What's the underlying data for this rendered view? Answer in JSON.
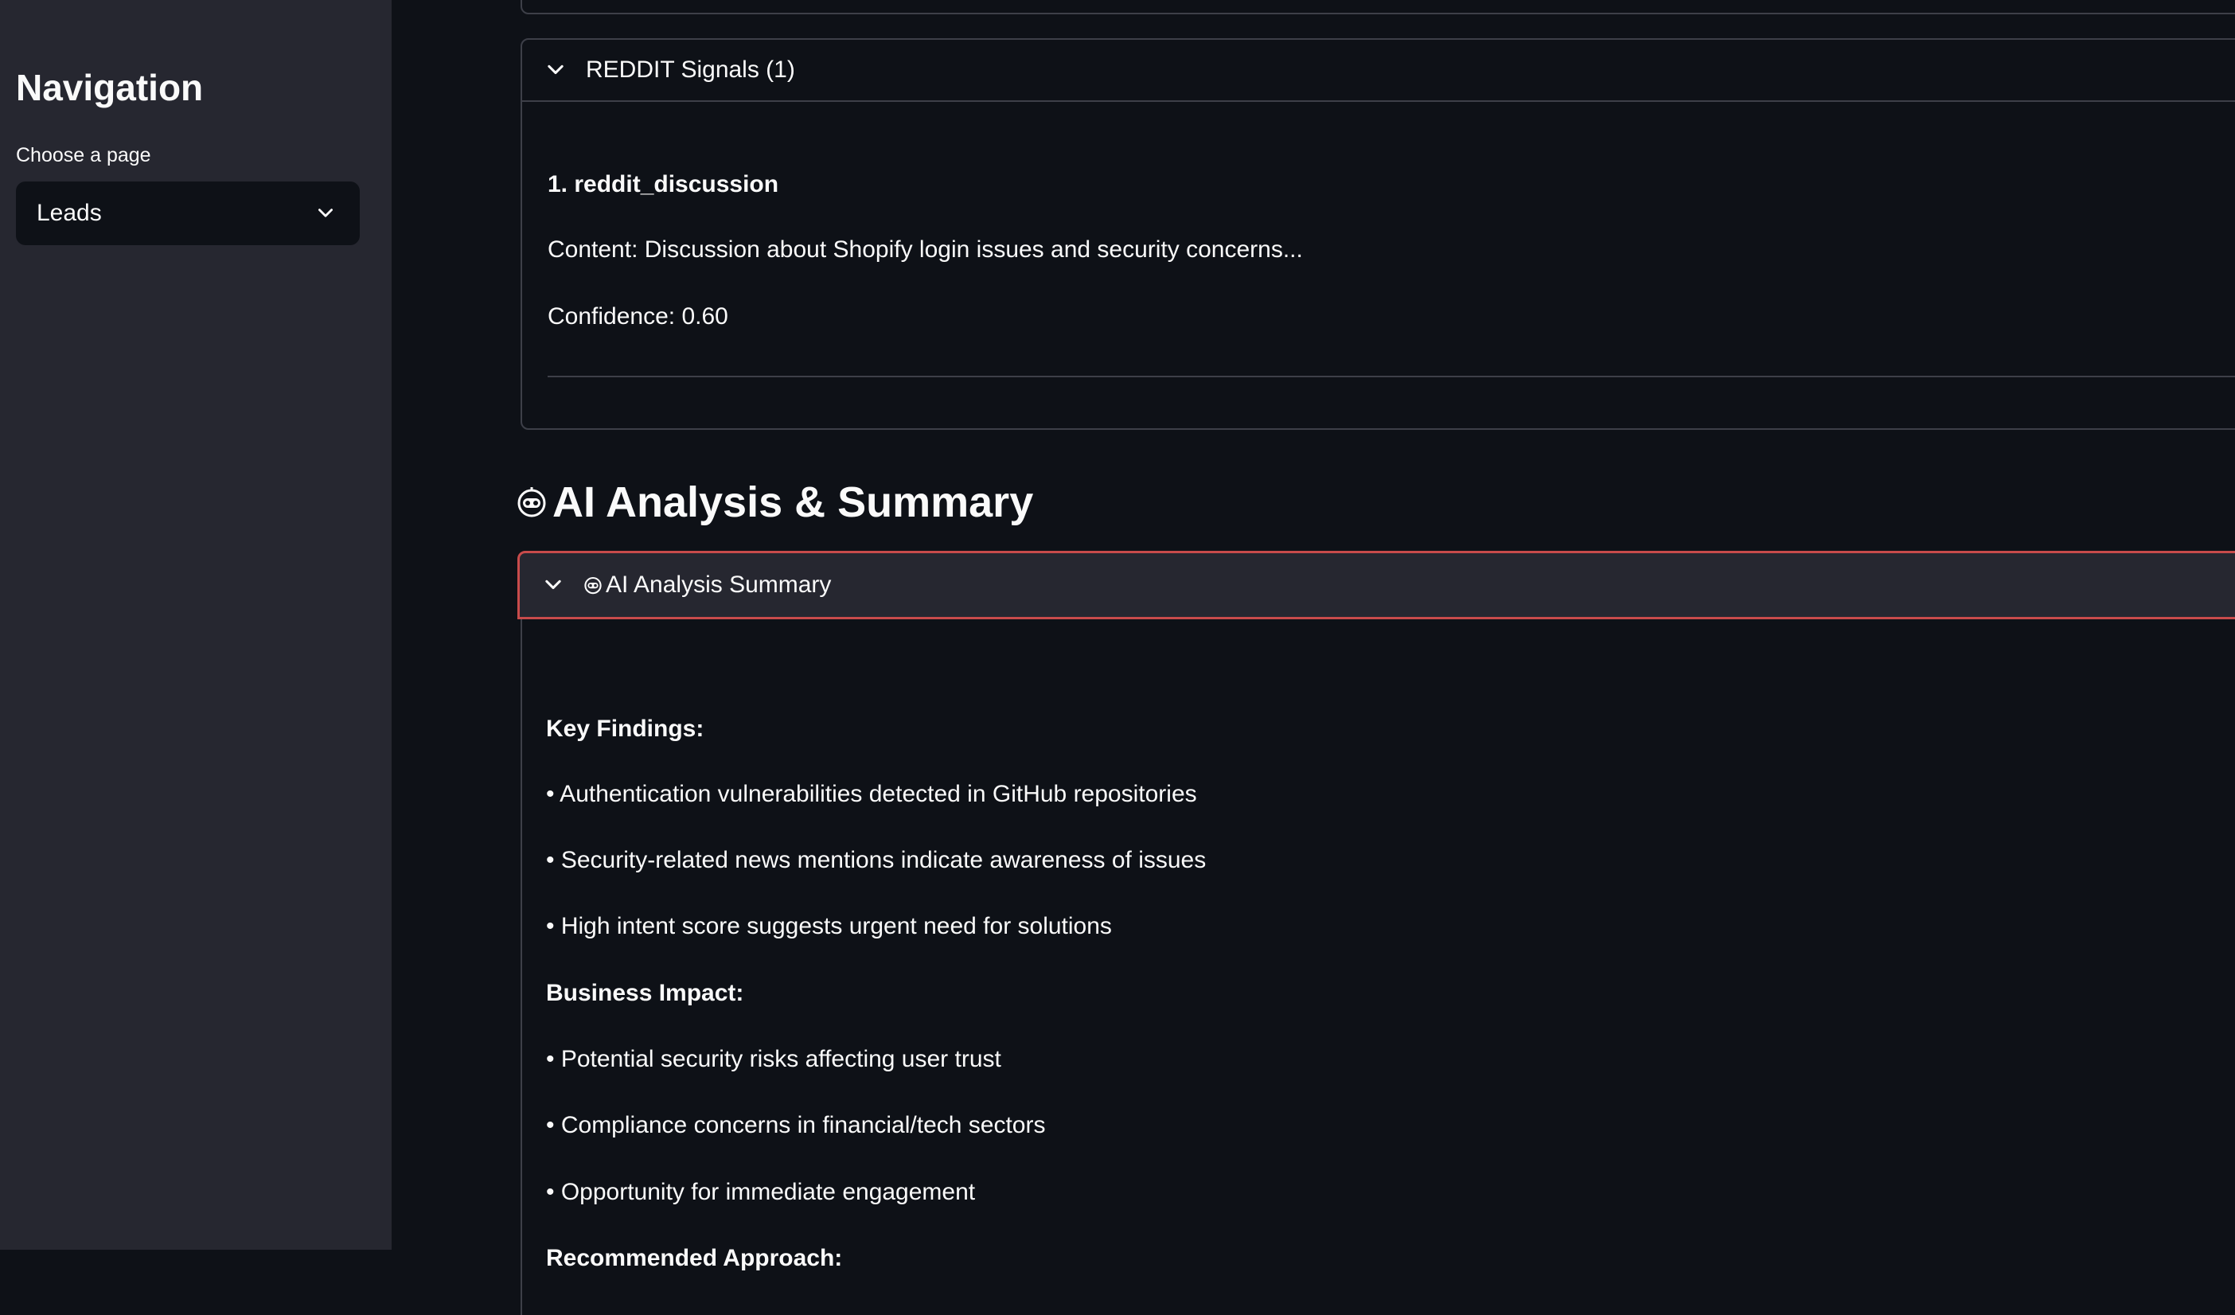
{
  "sidebar": {
    "title": "Navigation",
    "select_label": "Choose a page",
    "selected_page": "Leads"
  },
  "reddit_expander": {
    "title": "REDDIT Signals (1)",
    "item_title": "1. reddit_discussion",
    "content": "Content: Discussion about Shopify login issues and security concerns...",
    "confidence": "Confidence: 0.60"
  },
  "ai_section": {
    "heading": "AI Analysis & Summary",
    "expander_title": "AI Analysis Summary",
    "key_findings_heading": "Key Findings:",
    "key_findings": [
      "• Authentication vulnerabilities detected in GitHub repositories",
      "• Security-related news mentions indicate awareness of issues",
      "• High intent score suggests urgent need for solutions"
    ],
    "business_impact_heading": "Business Impact:",
    "business_impact": [
      "• Potential security risks affecting user trust",
      "• Compliance concerns in financial/tech sectors",
      "• Opportunity for immediate engagement"
    ],
    "recommended_heading": "Recommended Approach:"
  },
  "icons": {
    "chevron": "chevron-down-icon",
    "robot": "robot-icon"
  },
  "colors": {
    "background": "#0e1117",
    "sidebar": "#262730",
    "accent_border": "#c84b4b",
    "text": "#fafafa"
  }
}
